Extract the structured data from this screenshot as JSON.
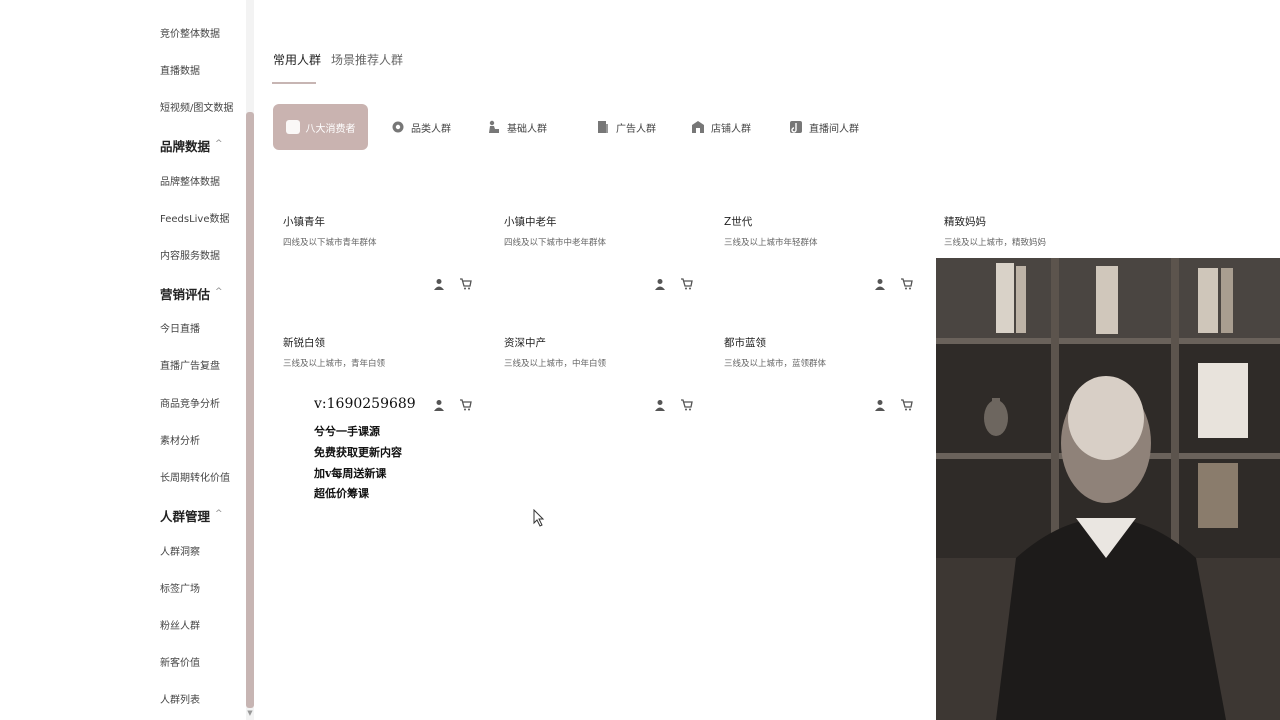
{
  "sidebar": {
    "items_top": [
      {
        "label": "竞价整体数据"
      },
      {
        "label": "直播数据"
      },
      {
        "label": "短视频/图文数据"
      }
    ],
    "groups": [
      {
        "label": "品牌数据",
        "items": [
          "品牌整体数据",
          "FeedsLive数据",
          "内容服务数据"
        ]
      },
      {
        "label": "营销评估",
        "items": [
          "今日直播",
          "直播广告复盘",
          "商品竞争分析",
          "素材分析",
          "长周期转化价值"
        ]
      },
      {
        "label": "人群管理",
        "items": [
          "人群洞察",
          "标签广场",
          "粉丝人群",
          "新客价值",
          "人群列表"
        ]
      }
    ]
  },
  "main_tabs": [
    "常用人群",
    "场景推荐人群"
  ],
  "chips": [
    "八大消费者",
    "品类人群",
    "基础人群",
    "广告人群",
    "店铺人群",
    "直播间人群"
  ],
  "cards": [
    {
      "title": "小镇青年",
      "desc": "四线及以下城市青年群体"
    },
    {
      "title": "小镇中老年",
      "desc": "四线及以下城市中老年群体"
    },
    {
      "title": "Z世代",
      "desc": "三线及以上城市年轻群体"
    },
    {
      "title": "精致妈妈",
      "desc": "三线及以上城市，精致妈妈"
    },
    {
      "title": "新锐白领",
      "desc": "三线及以上城市，青年白领"
    },
    {
      "title": "资深中产",
      "desc": "三线及以上城市，中年白领"
    },
    {
      "title": "都市蓝领",
      "desc": "三线及以上城市，蓝领群体"
    }
  ],
  "watermark": {
    "contact": "v:1690259689",
    "lines": [
      "兮兮一手课源",
      "免费获取更新内容",
      "加v每周送新课",
      "超低价筹课"
    ]
  },
  "colors": {
    "accent": "#c9b3b0",
    "scroll_thumb": "#c7b5b3"
  }
}
